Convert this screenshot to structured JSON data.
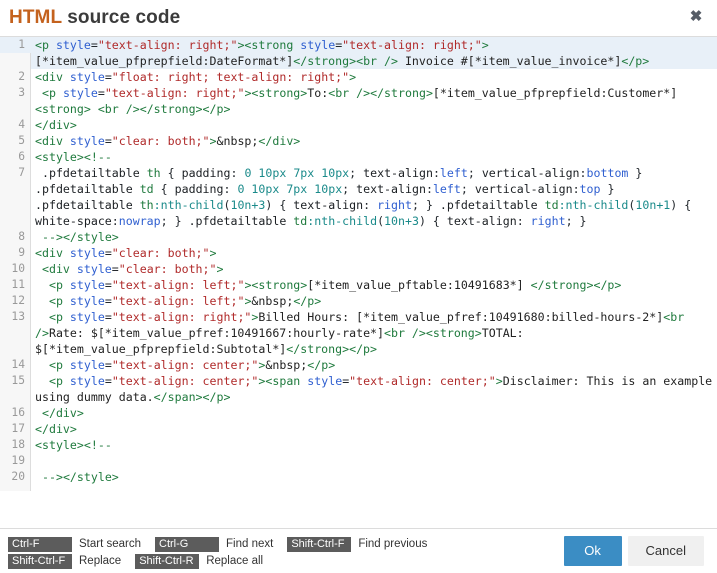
{
  "dialog": {
    "title_primary": "HTML",
    "title_rest": " source code",
    "close_label": "✖"
  },
  "editor": {
    "active_line": 1,
    "lines": [
      {
        "num": "1",
        "tokens": [
          {
            "c": "t-tag",
            "t": "<p "
          },
          {
            "c": "t-attr",
            "t": "style"
          },
          {
            "c": "t-punct",
            "t": "="
          },
          {
            "c": "t-str",
            "t": "\"text-align: right;\""
          },
          {
            "c": "t-tag",
            "t": "><strong "
          },
          {
            "c": "t-attr",
            "t": "style"
          },
          {
            "c": "t-punct",
            "t": "="
          },
          {
            "c": "t-str",
            "t": "\"text-align: right;\""
          },
          {
            "c": "t-tag",
            "t": ">"
          },
          {
            "c": "t-txt",
            "t": "[*item_value_pfprepfield:DateFormat*]"
          },
          {
            "c": "t-tag",
            "t": "</strong><br />"
          },
          {
            "c": "t-txt",
            "t": " Invoice #[*item_value_invoice*]"
          },
          {
            "c": "t-tag",
            "t": "</p>"
          }
        ]
      },
      {
        "num": "2",
        "tokens": [
          {
            "c": "t-tag",
            "t": "<div "
          },
          {
            "c": "t-attr",
            "t": "style"
          },
          {
            "c": "t-punct",
            "t": "="
          },
          {
            "c": "t-str",
            "t": "\"float: right; text-align: right;\""
          },
          {
            "c": "t-tag",
            "t": ">"
          }
        ]
      },
      {
        "num": "3",
        "tokens": [
          {
            "c": "t-txt",
            "t": " "
          },
          {
            "c": "t-tag",
            "t": "<p "
          },
          {
            "c": "t-attr",
            "t": "style"
          },
          {
            "c": "t-punct",
            "t": "="
          },
          {
            "c": "t-str",
            "t": "\"text-align: right;\""
          },
          {
            "c": "t-tag",
            "t": "><strong>"
          },
          {
            "c": "t-txt",
            "t": "To:"
          },
          {
            "c": "t-tag",
            "t": "<br /></strong>"
          },
          {
            "c": "t-txt",
            "t": "[*item_value_pfprepfield:Customer*]"
          },
          {
            "c": "t-tag",
            "t": "<strong>"
          },
          {
            "c": "t-txt",
            "t": " "
          },
          {
            "c": "t-tag",
            "t": "<br /></strong></p>"
          }
        ]
      },
      {
        "num": "4",
        "tokens": [
          {
            "c": "t-tag",
            "t": "</div>"
          }
        ]
      },
      {
        "num": "5",
        "tokens": [
          {
            "c": "t-tag",
            "t": "<div "
          },
          {
            "c": "t-attr",
            "t": "style"
          },
          {
            "c": "t-punct",
            "t": "="
          },
          {
            "c": "t-str",
            "t": "\"clear: both;\""
          },
          {
            "c": "t-tag",
            "t": ">"
          },
          {
            "c": "t-txt",
            "t": "&nbsp;"
          },
          {
            "c": "t-tag",
            "t": "</div>"
          }
        ]
      },
      {
        "num": "6",
        "tokens": [
          {
            "c": "t-tag",
            "t": "<style>"
          },
          {
            "c": "t-cmt",
            "t": "<!--"
          }
        ]
      },
      {
        "num": "7",
        "tokens": [
          {
            "c": "t-txt",
            "t": " "
          },
          {
            "c": "t-prop",
            "t": ".pfdetailtable "
          },
          {
            "c": "t-sel",
            "t": "th"
          },
          {
            "c": "t-punct",
            "t": " { "
          },
          {
            "c": "t-prop",
            "t": "padding"
          },
          {
            "c": "t-punct",
            "t": ": "
          },
          {
            "c": "t-num",
            "t": "0 10px 7px 10px"
          },
          {
            "c": "t-punct",
            "t": "; "
          },
          {
            "c": "t-prop",
            "t": "text-align"
          },
          {
            "c": "t-punct",
            "t": ":"
          },
          {
            "c": "t-kw",
            "t": "left"
          },
          {
            "c": "t-punct",
            "t": "; "
          },
          {
            "c": "t-prop",
            "t": "vertical-align"
          },
          {
            "c": "t-punct",
            "t": ":"
          },
          {
            "c": "t-kw",
            "t": "bottom"
          },
          {
            "c": "t-punct",
            "t": " } "
          },
          {
            "c": "t-prop",
            "t": ".pfdetailtable "
          },
          {
            "c": "t-sel",
            "t": "td"
          },
          {
            "c": "t-punct",
            "t": " { "
          },
          {
            "c": "t-prop",
            "t": "padding"
          },
          {
            "c": "t-punct",
            "t": ": "
          },
          {
            "c": "t-num",
            "t": "0 10px 7px 10px"
          },
          {
            "c": "t-punct",
            "t": "; "
          },
          {
            "c": "t-prop",
            "t": "text-align"
          },
          {
            "c": "t-punct",
            "t": ":"
          },
          {
            "c": "t-kw",
            "t": "left"
          },
          {
            "c": "t-punct",
            "t": "; "
          },
          {
            "c": "t-prop",
            "t": "vertical-align"
          },
          {
            "c": "t-punct",
            "t": ":"
          },
          {
            "c": "t-kw",
            "t": "top"
          },
          {
            "c": "t-punct",
            "t": " } "
          },
          {
            "c": "t-prop",
            "t": ".pfdetailtable "
          },
          {
            "c": "t-sel",
            "t": "th"
          },
          {
            "c": "t-pseudo",
            "t": ":nth-child"
          },
          {
            "c": "t-punct",
            "t": "("
          },
          {
            "c": "t-num",
            "t": "10n+3"
          },
          {
            "c": "t-punct",
            "t": ") { "
          },
          {
            "c": "t-prop",
            "t": "text-align"
          },
          {
            "c": "t-punct",
            "t": ": "
          },
          {
            "c": "t-kw",
            "t": "right"
          },
          {
            "c": "t-punct",
            "t": "; } "
          },
          {
            "c": "t-prop",
            "t": ".pfdetailtable "
          },
          {
            "c": "t-sel",
            "t": "td"
          },
          {
            "c": "t-pseudo",
            "t": ":nth-child"
          },
          {
            "c": "t-punct",
            "t": "("
          },
          {
            "c": "t-num",
            "t": "10n+1"
          },
          {
            "c": "t-punct",
            "t": ") { "
          },
          {
            "c": "t-prop",
            "t": "white-space"
          },
          {
            "c": "t-punct",
            "t": ":"
          },
          {
            "c": "t-kw",
            "t": "nowrap"
          },
          {
            "c": "t-punct",
            "t": "; } "
          },
          {
            "c": "t-prop",
            "t": ".pfdetailtable "
          },
          {
            "c": "t-sel",
            "t": "td"
          },
          {
            "c": "t-pseudo",
            "t": ":nth-child"
          },
          {
            "c": "t-punct",
            "t": "("
          },
          {
            "c": "t-num",
            "t": "10n+3"
          },
          {
            "c": "t-punct",
            "t": ") { "
          },
          {
            "c": "t-prop",
            "t": "text-align"
          },
          {
            "c": "t-punct",
            "t": ": "
          },
          {
            "c": "t-kw",
            "t": "right"
          },
          {
            "c": "t-punct",
            "t": "; }"
          }
        ]
      },
      {
        "num": "8",
        "tokens": [
          {
            "c": "t-cmt",
            "t": " -->"
          },
          {
            "c": "t-tag",
            "t": "</style>"
          }
        ]
      },
      {
        "num": "9",
        "tokens": [
          {
            "c": "t-tag",
            "t": "<div "
          },
          {
            "c": "t-attr",
            "t": "style"
          },
          {
            "c": "t-punct",
            "t": "="
          },
          {
            "c": "t-str",
            "t": "\"clear: both;\""
          },
          {
            "c": "t-tag",
            "t": ">"
          }
        ]
      },
      {
        "num": "10",
        "tokens": [
          {
            "c": "t-txt",
            "t": " "
          },
          {
            "c": "t-tag",
            "t": "<div "
          },
          {
            "c": "t-attr",
            "t": "style"
          },
          {
            "c": "t-punct",
            "t": "="
          },
          {
            "c": "t-str",
            "t": "\"clear: both;\""
          },
          {
            "c": "t-tag",
            "t": ">"
          }
        ]
      },
      {
        "num": "11",
        "tokens": [
          {
            "c": "t-txt",
            "t": "  "
          },
          {
            "c": "t-tag",
            "t": "<p "
          },
          {
            "c": "t-attr",
            "t": "style"
          },
          {
            "c": "t-punct",
            "t": "="
          },
          {
            "c": "t-str",
            "t": "\"text-align: left;\""
          },
          {
            "c": "t-tag",
            "t": "><strong>"
          },
          {
            "c": "t-txt",
            "t": "[*item_value_pftable:10491683*] "
          },
          {
            "c": "t-tag",
            "t": "</strong></p>"
          }
        ]
      },
      {
        "num": "12",
        "tokens": [
          {
            "c": "t-txt",
            "t": "  "
          },
          {
            "c": "t-tag",
            "t": "<p "
          },
          {
            "c": "t-attr",
            "t": "style"
          },
          {
            "c": "t-punct",
            "t": "="
          },
          {
            "c": "t-str",
            "t": "\"text-align: left;\""
          },
          {
            "c": "t-tag",
            "t": ">"
          },
          {
            "c": "t-txt",
            "t": "&nbsp;"
          },
          {
            "c": "t-tag",
            "t": "</p>"
          }
        ]
      },
      {
        "num": "13",
        "tokens": [
          {
            "c": "t-txt",
            "t": "  "
          },
          {
            "c": "t-tag",
            "t": "<p "
          },
          {
            "c": "t-attr",
            "t": "style"
          },
          {
            "c": "t-punct",
            "t": "="
          },
          {
            "c": "t-str",
            "t": "\"text-align: right;\""
          },
          {
            "c": "t-tag",
            "t": ">"
          },
          {
            "c": "t-txt",
            "t": "Billed Hours: [*item_value_pfref:10491680:billed-hours-2*]"
          },
          {
            "c": "t-tag",
            "t": "<br />"
          },
          {
            "c": "t-txt",
            "t": "Rate: $[*item_value_pfref:10491667:hourly-rate*]"
          },
          {
            "c": "t-tag",
            "t": "<br /><strong>"
          },
          {
            "c": "t-txt",
            "t": "TOTAL: $[*item_value_pfprepfield:Subtotal*]"
          },
          {
            "c": "t-tag",
            "t": "</strong></p>"
          }
        ]
      },
      {
        "num": "14",
        "tokens": [
          {
            "c": "t-txt",
            "t": "  "
          },
          {
            "c": "t-tag",
            "t": "<p "
          },
          {
            "c": "t-attr",
            "t": "style"
          },
          {
            "c": "t-punct",
            "t": "="
          },
          {
            "c": "t-str",
            "t": "\"text-align: center;\""
          },
          {
            "c": "t-tag",
            "t": ">"
          },
          {
            "c": "t-txt",
            "t": "&nbsp;"
          },
          {
            "c": "t-tag",
            "t": "</p>"
          }
        ]
      },
      {
        "num": "15",
        "tokens": [
          {
            "c": "t-txt",
            "t": "  "
          },
          {
            "c": "t-tag",
            "t": "<p "
          },
          {
            "c": "t-attr",
            "t": "style"
          },
          {
            "c": "t-punct",
            "t": "="
          },
          {
            "c": "t-str",
            "t": "\"text-align: center;\""
          },
          {
            "c": "t-tag",
            "t": "><span "
          },
          {
            "c": "t-attr",
            "t": "style"
          },
          {
            "c": "t-punct",
            "t": "="
          },
          {
            "c": "t-str",
            "t": "\"text-align: center;\""
          },
          {
            "c": "t-tag",
            "t": ">"
          },
          {
            "c": "t-txt",
            "t": "Disclaimer: This is an example using dummy data."
          },
          {
            "c": "t-tag",
            "t": "</span></p>"
          }
        ]
      },
      {
        "num": "16",
        "tokens": [
          {
            "c": "t-txt",
            "t": " "
          },
          {
            "c": "t-tag",
            "t": "</div>"
          }
        ]
      },
      {
        "num": "17",
        "tokens": [
          {
            "c": "t-tag",
            "t": "</div>"
          }
        ]
      },
      {
        "num": "18",
        "tokens": [
          {
            "c": "t-tag",
            "t": "<style>"
          },
          {
            "c": "t-cmt",
            "t": "<!--"
          }
        ]
      },
      {
        "num": "19",
        "tokens": []
      },
      {
        "num": "20",
        "tokens": [
          {
            "c": "t-cmt",
            "t": " -->"
          },
          {
            "c": "t-tag",
            "t": "</style>"
          }
        ]
      }
    ]
  },
  "footer": {
    "shortcuts": [
      [
        {
          "key": "Ctrl-F",
          "label": "Start search"
        },
        {
          "key": "Ctrl-G",
          "label": "Find next"
        },
        {
          "key": "Shift-Ctrl-F",
          "label": "Find previous"
        }
      ],
      [
        {
          "key": "Shift-Ctrl-F",
          "label": "Replace"
        },
        {
          "key": "Shift-Ctrl-R",
          "label": "Replace all"
        }
      ]
    ],
    "ok_label": "Ok",
    "cancel_label": "Cancel"
  },
  "colors": {
    "accent": "#3b8dc4",
    "title_keyword": "#c4621e",
    "active_line": "#e8f0f8",
    "key_badge": "#5c5c5c"
  }
}
